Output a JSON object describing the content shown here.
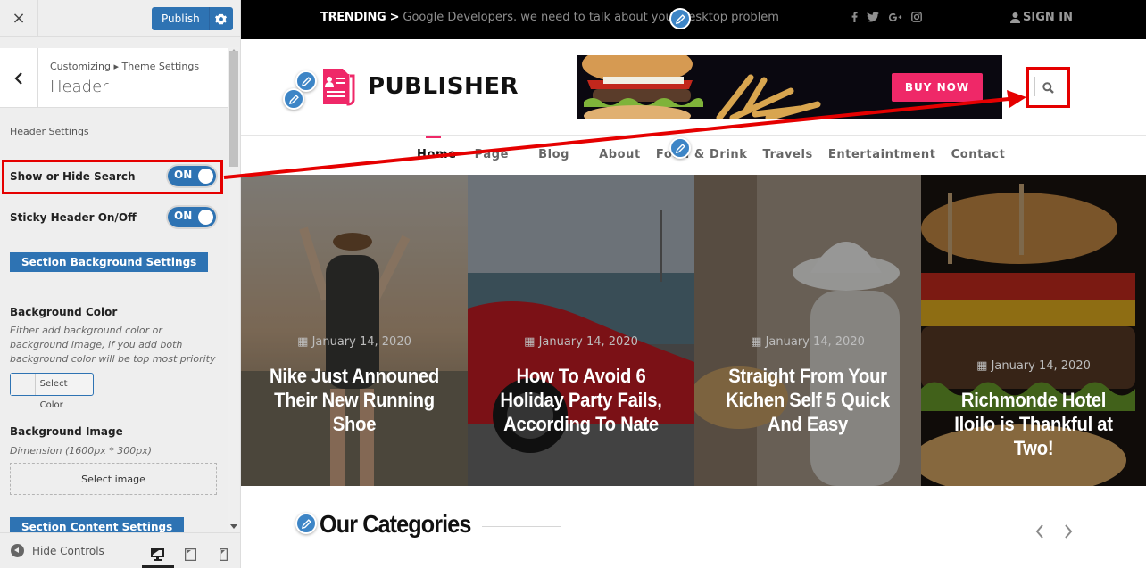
{
  "customizer": {
    "close_label": "×",
    "publish_label": "Publish",
    "breadcrumb": "Customizing ▸ Theme Settings",
    "panel_title": "Header",
    "section_label": "Header Settings",
    "controls": [
      {
        "label": "Show or Hide Search",
        "state": "ON"
      },
      {
        "label": "Sticky Header On/Off",
        "state": "ON"
      }
    ],
    "section_background_button": "Section Background Settings",
    "background_color": {
      "title": "Background Color",
      "description": "Either add background color or background image, if you add both background color will be top most priority",
      "button_label": "Select Color"
    },
    "background_image": {
      "title": "Background Image",
      "dimension": "Dimension (1600px * 300px)",
      "button_label": "Select image"
    },
    "section_content_button": "Section Content Settings",
    "footer": {
      "hide_controls_label": "Hide Controls",
      "devices": [
        "desktop",
        "tablet",
        "mobile"
      ],
      "active_device": "desktop"
    }
  },
  "site": {
    "topbar": {
      "trending_label": "TRENDING >",
      "trending_text": "Google Developers. we need to talk about your desktop problem",
      "socials": [
        "facebook",
        "twitter",
        "google-plus",
        "instagram"
      ],
      "signin_label": "SIGN IN"
    },
    "logo_text": "PUBLISHER",
    "ad": {
      "button_label": "BUY NOW"
    },
    "nav": [
      {
        "label": "Home",
        "active": true
      },
      {
        "label": "Page",
        "active": false
      },
      {
        "label": "Blog",
        "active": false
      },
      {
        "label": "About",
        "active": false
      },
      {
        "label": "Food & Drink",
        "active": false
      },
      {
        "label": "Travels",
        "active": false
      },
      {
        "label": "Entertaintment",
        "active": false
      },
      {
        "label": "Contact",
        "active": false
      }
    ],
    "slides": [
      {
        "date": "January 14, 2020",
        "title": "Nike Just Announed Their New Running Shoe"
      },
      {
        "date": "January 14, 2020",
        "title": "How To Avoid 6 Holiday Party Fails, According To Nate"
      },
      {
        "date": "January 14, 2020",
        "title": "Straight From Your Kichen Self 5 Quick And Easy"
      },
      {
        "date": "January 14, 2020",
        "title": "Richmonde Hotel Iloilo is Thankful at Two!"
      }
    ],
    "categories_title": "Our Categories",
    "carousel_prev": "‹",
    "carousel_next": "›"
  },
  "colors": {
    "accent_blue": "#2e73b3",
    "brand_pink": "#ef2868",
    "annotation_red": "#e50000",
    "edit_shortcut_blue": "#3d85c6"
  }
}
